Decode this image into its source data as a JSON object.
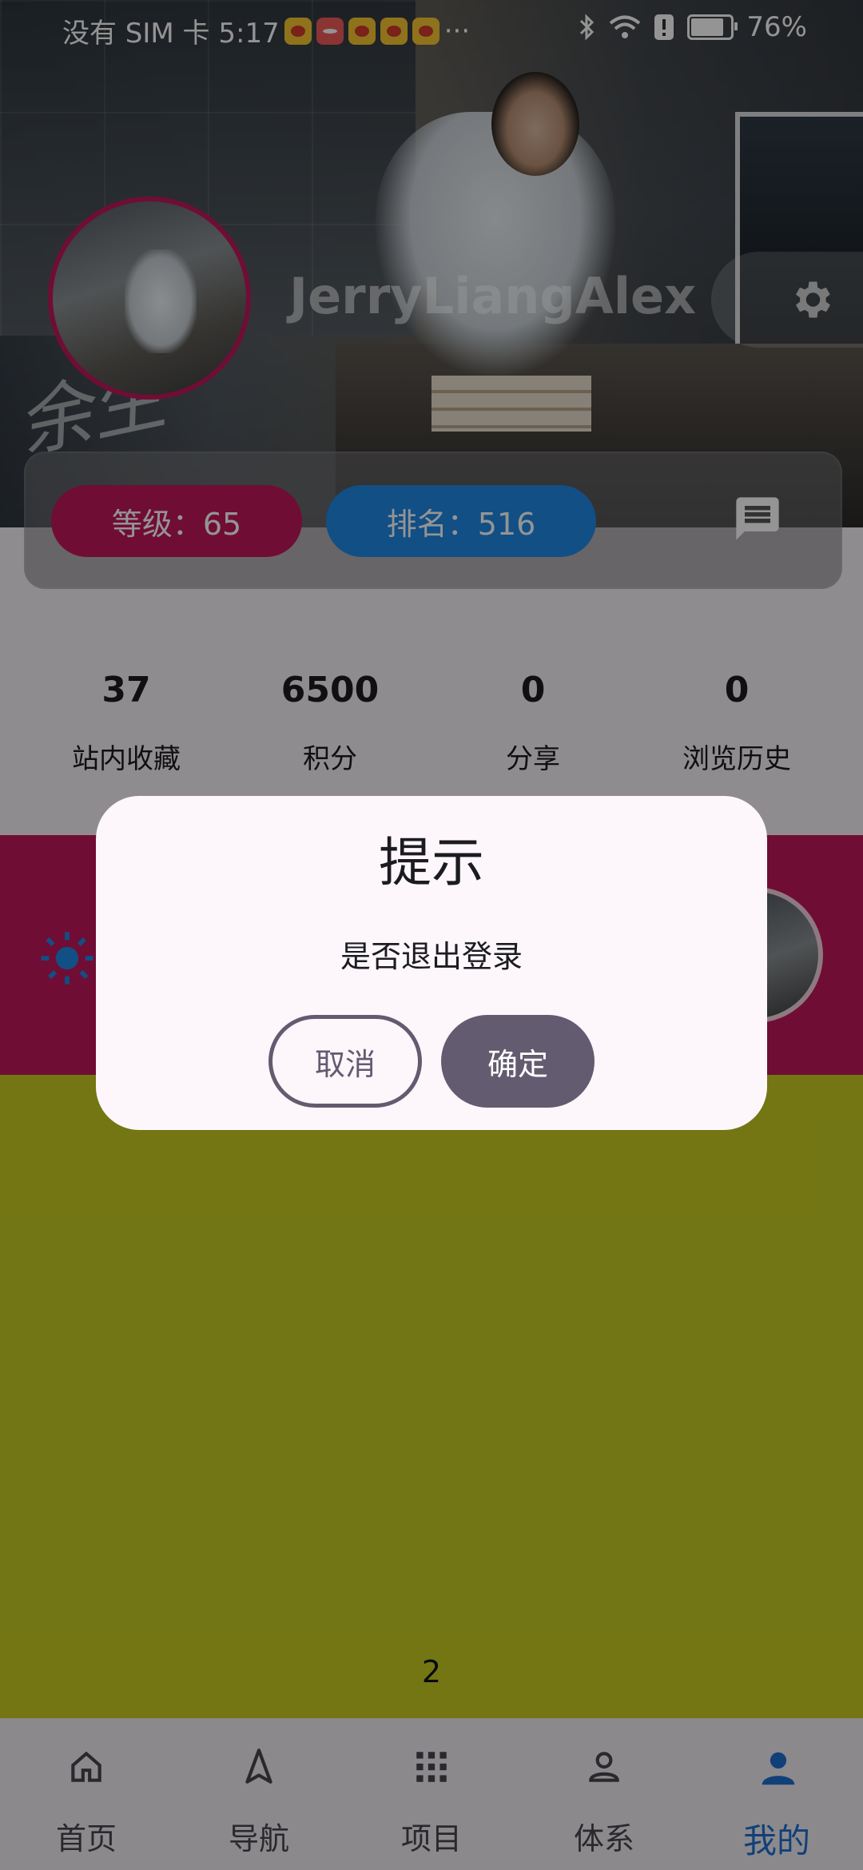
{
  "status_bar": {
    "carrier_time": "没有 SIM 卡 5:17",
    "more": "···",
    "battery": "76%"
  },
  "profile": {
    "username": "JerryLiangAlex",
    "level": "等级：65",
    "rank": "排名：516",
    "watermark": "余生"
  },
  "stats": [
    {
      "value": "37",
      "label": "站内收藏"
    },
    {
      "value": "6500",
      "label": "积分"
    },
    {
      "value": "0",
      "label": "分享"
    },
    {
      "value": "0",
      "label": "浏览历史"
    }
  ],
  "content": {
    "page_indicator": "2"
  },
  "dialog": {
    "title": "提示",
    "message": "是否退出登录",
    "cancel_label": "取消",
    "confirm_label": "确定"
  },
  "bottom_nav": [
    {
      "label": "首页",
      "icon": "home-icon"
    },
    {
      "label": "导航",
      "icon": "navigation-icon"
    },
    {
      "label": "项目",
      "icon": "grid-icon"
    },
    {
      "label": "体系",
      "icon": "person-outline-icon"
    },
    {
      "label": "我的",
      "icon": "person-filled-icon",
      "active": true
    }
  ],
  "colors": {
    "accent_pink": "#c2185b",
    "accent_blue": "#1e88e5",
    "yellow_area": "#c7cb22",
    "dialog_button": "#635b70",
    "nav_active": "#1e6fd0"
  }
}
